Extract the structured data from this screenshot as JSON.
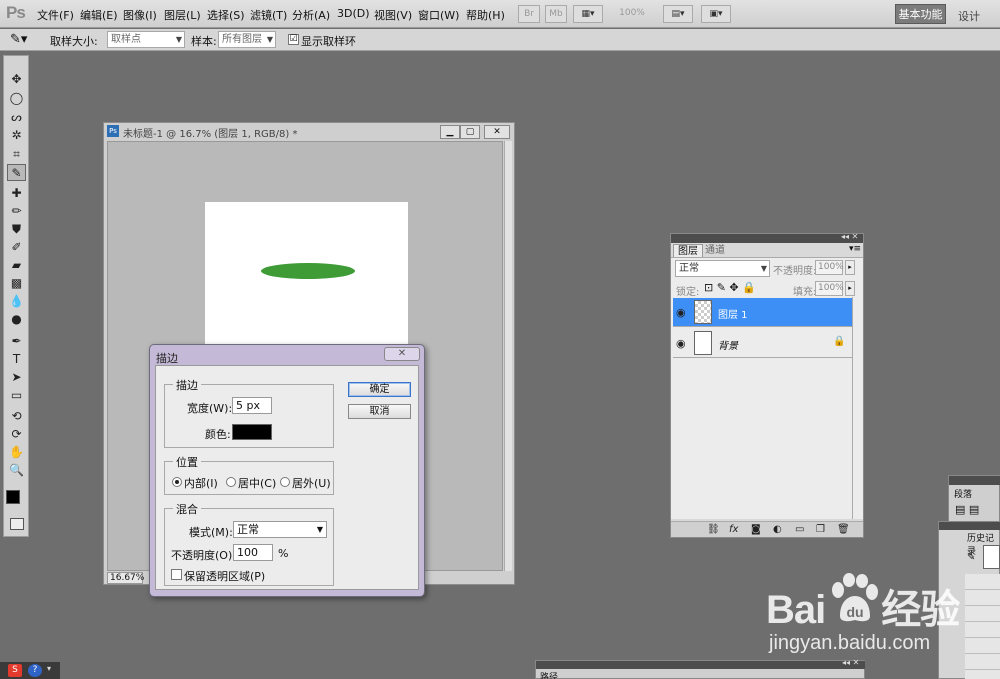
{
  "app": {
    "logo": "Ps"
  },
  "menu": [
    "文件(F)",
    "编辑(E)",
    "图像(I)",
    "图层(L)",
    "选择(S)",
    "滤镜(T)",
    "分析(A)",
    "3D(D)",
    "视图(V)",
    "窗口(W)",
    "帮助(H)"
  ],
  "toolbar_top": {
    "zoom": "100%",
    "br": "Br",
    "mb": "Mb"
  },
  "workspace": {
    "active": "基本功能",
    "other": "设计"
  },
  "options": {
    "sample_size_label": "取样大小:",
    "sample_size_value": "取样点",
    "sample_label": "样本:",
    "sample_value": "所有图层",
    "show_ring_label": "显示取样环",
    "show_ring_checked": "☑"
  },
  "document": {
    "title": "未标题-1 @ 16.7% (图层 1, RGB/8) *",
    "zoom": "16.67%",
    "ellipse_color": "#3f9b35"
  },
  "dialog": {
    "title": "描边",
    "stroke_group": "描边",
    "width_label": "宽度(W):",
    "width_value": "5 px",
    "color_label": "颜色:",
    "stroke_color": "#000000",
    "position_group": "位置",
    "inside_label": "内部(I)",
    "center_label": "居中(C)",
    "outside_label": "居外(U)",
    "blend_group": "混合",
    "mode_label": "模式(M):",
    "mode_value": "正常",
    "opacity_label": "不透明度(O):",
    "opacity_value": "100",
    "opacity_unit": "%",
    "preserve_label": "保留透明区域(P)",
    "ok_label": "确定",
    "cancel_label": "取消"
  },
  "layers_panel": {
    "tabs": [
      "图层",
      "通道"
    ],
    "blend_mode": "正常",
    "opacity_label": "不透明度:",
    "opacity_value": "100%",
    "lock_label": "锁定:",
    "fill_label": "填充:",
    "fill_value": "100%",
    "layers": [
      {
        "name": "图层 1",
        "selected": true
      },
      {
        "name": "背景",
        "selected": false
      }
    ]
  },
  "side_panels": {
    "paragraph": "段落",
    "history": "历史记录",
    "paths": "路径"
  },
  "watermark": {
    "logo_left": "Bai",
    "logo_right": "经验",
    "url": "jingyan.baidu.com"
  }
}
